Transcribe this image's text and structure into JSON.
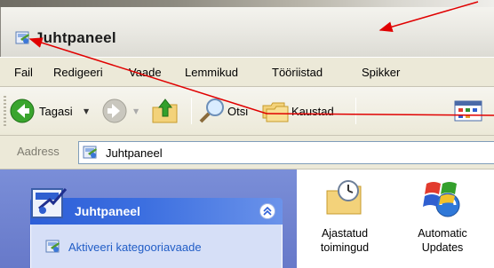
{
  "window": {
    "title": "Juhtpaneel"
  },
  "menu": {
    "items": [
      {
        "label": "Fail"
      },
      {
        "label": "Redigeeri"
      },
      {
        "label": "Vaade"
      },
      {
        "label": "Lemmikud"
      },
      {
        "label": "Tööriistad"
      },
      {
        "label": "Spikker"
      }
    ]
  },
  "toolbar": {
    "back_label": "Tagasi",
    "search_label": "Otsi",
    "folders_label": "Kaustad"
  },
  "address": {
    "label": "Aadress",
    "value": "Juhtpaneel"
  },
  "left_panel": {
    "title": "Juhtpaneel",
    "link": "Aktiveeri kategooriavaade"
  },
  "content": {
    "items": [
      {
        "label_line1": "Ajastatud",
        "label_line2": "toimingud",
        "icon": "scheduled-tasks-icon"
      },
      {
        "label_line1": "Automatic",
        "label_line2": "Updates",
        "icon": "automatic-updates-icon"
      }
    ]
  },
  "colors": {
    "panel_header": "#2d5fd8",
    "left_pane": "#6f83d0",
    "link": "#215dc6",
    "annotation_arrow": "#e00000"
  }
}
